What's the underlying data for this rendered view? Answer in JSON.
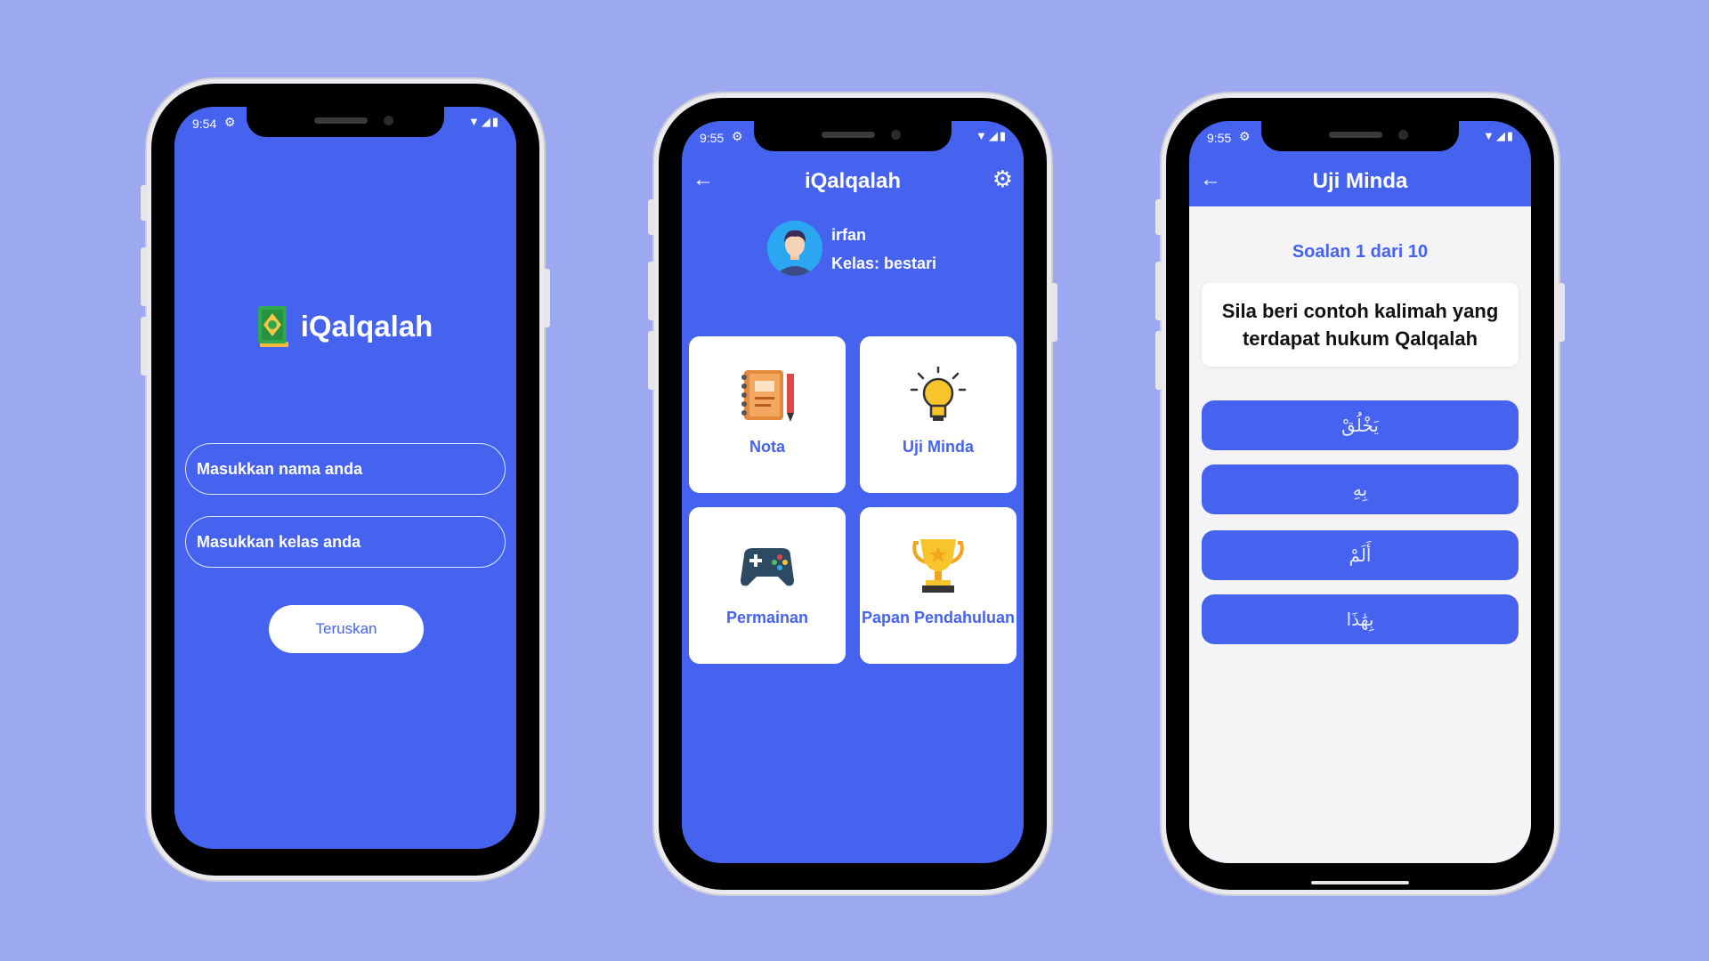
{
  "colors": {
    "background": "#9ca8ef",
    "primary": "#4663f0",
    "card": "#ffffff"
  },
  "login_screen": {
    "status_time": "9:54",
    "app_name": "iQalqalah",
    "logo_icon": "quran-book-icon",
    "name_placeholder": "Masukkan nama anda",
    "class_placeholder": "Masukkan kelas anda",
    "continue_label": "Teruskan"
  },
  "home_screen": {
    "status_time": "9:55",
    "title": "iQalqalah",
    "user": {
      "name": "irfan",
      "class_label": "Kelas: bestari"
    },
    "menu": [
      {
        "label": "Nota",
        "icon": "notebook-icon"
      },
      {
        "label": "Uji Minda",
        "icon": "lightbulb-icon"
      },
      {
        "label": "Permainan",
        "icon": "gamepad-icon"
      },
      {
        "label": "Papan Pendahuluan",
        "icon": "trophy-icon"
      }
    ]
  },
  "quiz_screen": {
    "status_time": "9:55",
    "title": "Uji Minda",
    "question_number": "Soalan 1 dari 10",
    "question": "Sila beri contoh kalimah yang terdapat hukum Qalqalah",
    "answers": [
      "يَخْلُقْ",
      "بِهِ",
      "أَلَمْ",
      "بِهَٰذَا"
    ]
  }
}
